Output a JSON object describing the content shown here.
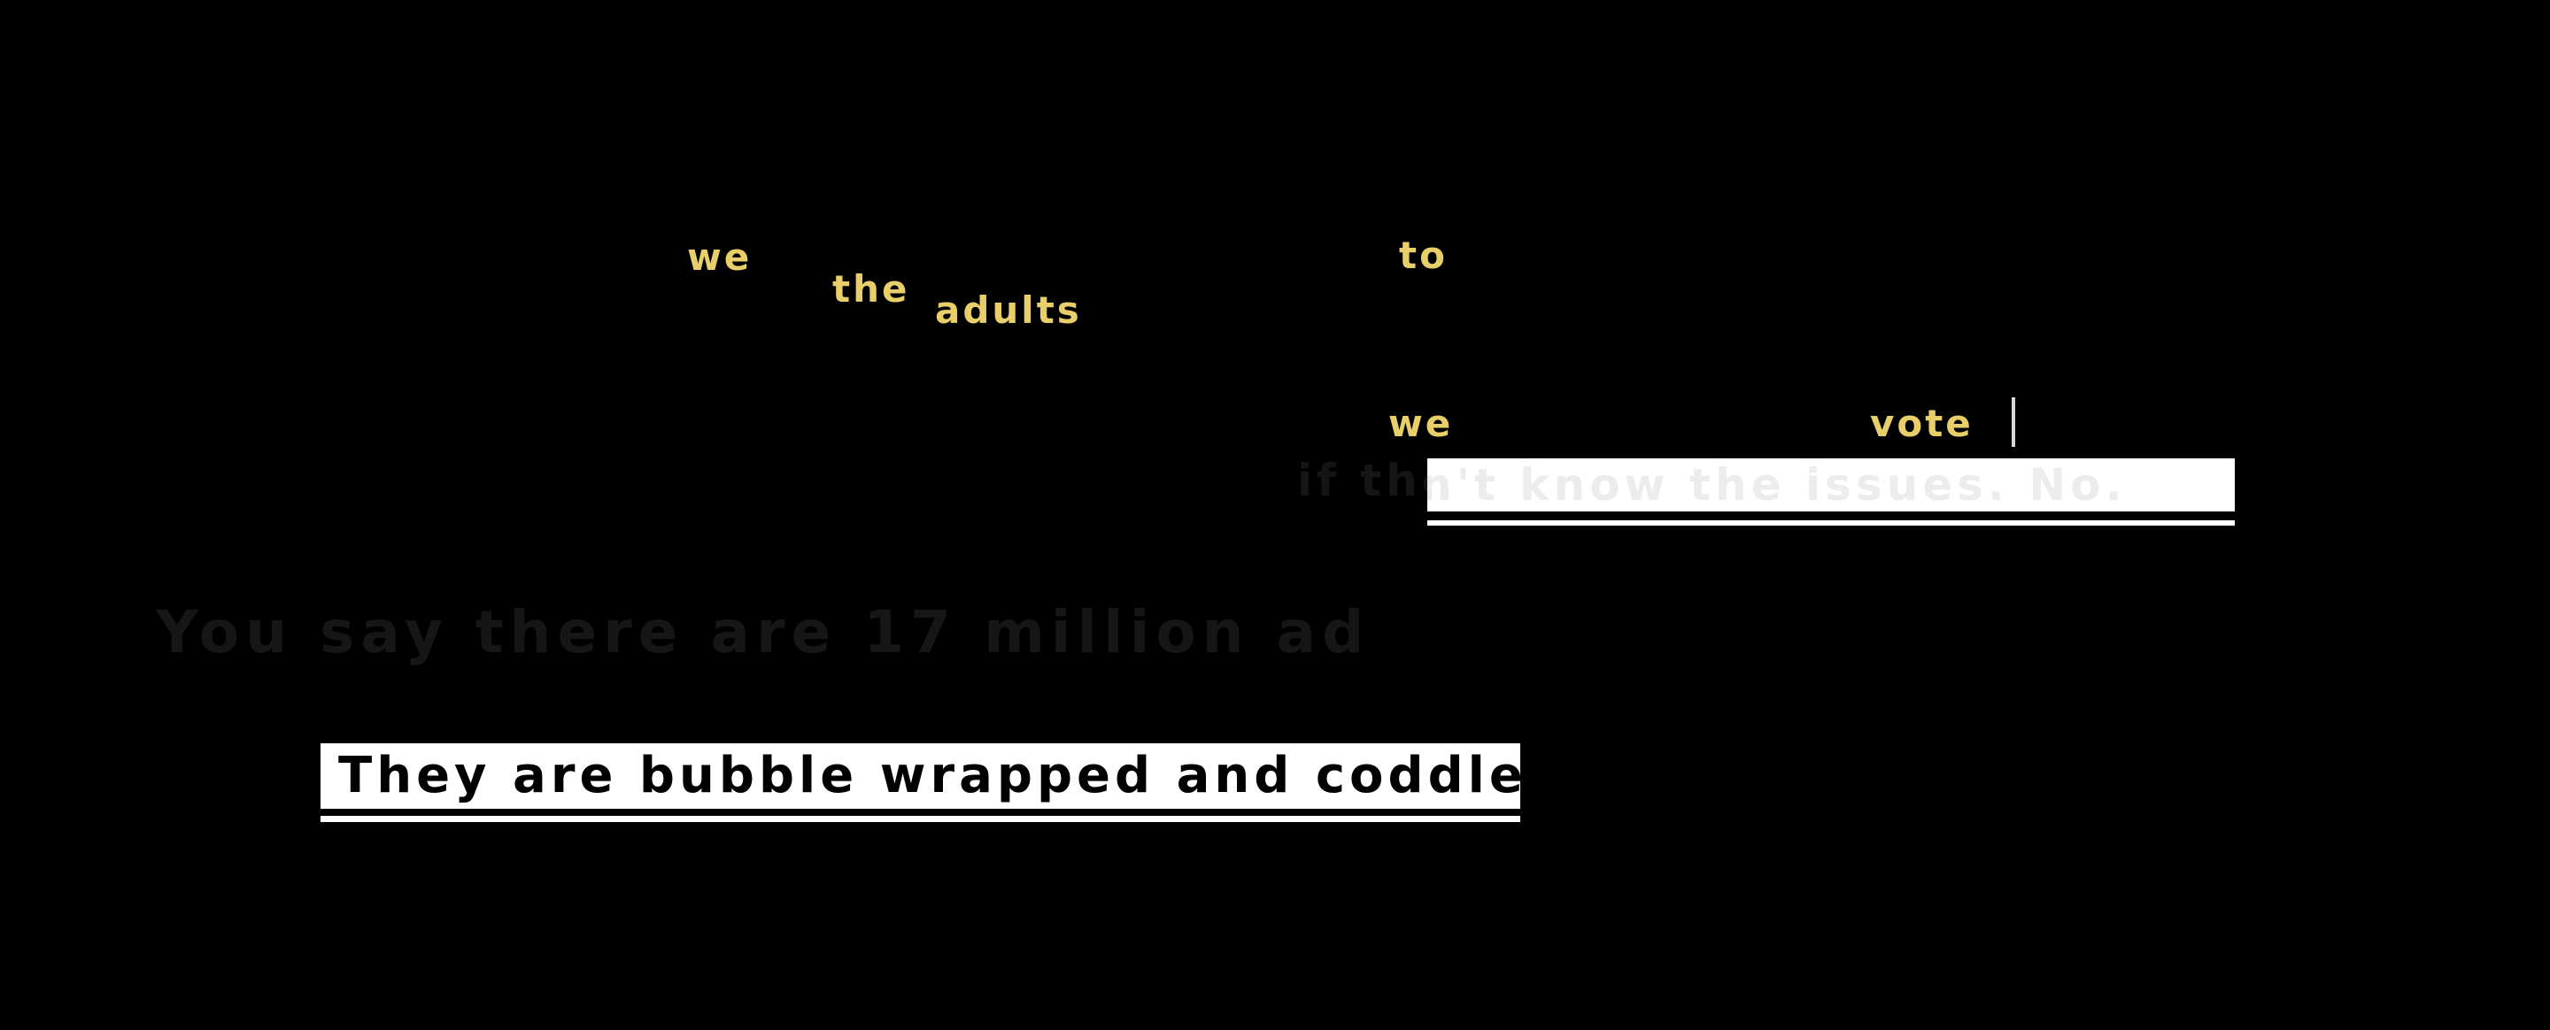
{
  "floating_words": [
    "we",
    "the",
    "adults",
    "to",
    "we",
    "vote"
  ],
  "faded_caption": {
    "leading": "if the",
    "boxed": "y don't know the issues. No."
  },
  "ghost_caption": "You say there are 17 million ad",
  "main_caption": "They are bubble wrapped and coddled.",
  "colors": {
    "background": "#000000",
    "floating_word": "#e8cf6a",
    "caption_box": "#ffffff",
    "caption_text": "#000000"
  }
}
